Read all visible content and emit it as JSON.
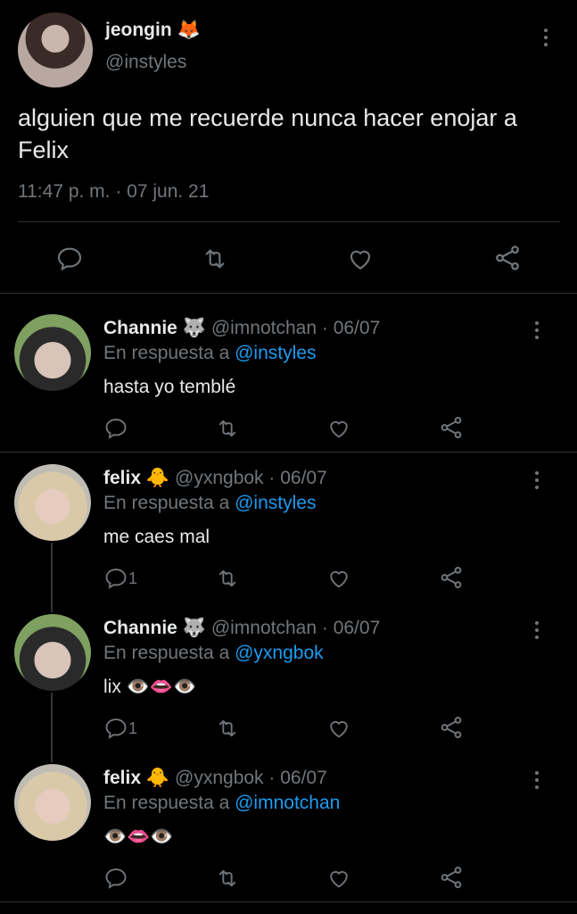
{
  "main_tweet": {
    "name": "jeongin 🦊",
    "handle": "@instyles",
    "text": "alguien que me recuerde nunca hacer enojar a Felix",
    "meta": "11:47 p. m. · 07 jun. 21"
  },
  "replies": [
    {
      "name": "Channie 🐺",
      "handle": "@imnotchan · 06/07",
      "reply_prefix": "En respuesta a",
      "mention": "@instyles",
      "text": "hasta yo temblé",
      "reply_count": ""
    },
    {
      "name": "felix 🐥",
      "handle": "@yxngbok · 06/07",
      "reply_prefix": "En respuesta a",
      "mention": "@instyles",
      "text": "me caes mal",
      "reply_count": "1"
    },
    {
      "name": "Channie 🐺",
      "handle": "@imnotchan · 06/07",
      "reply_prefix": "En respuesta a",
      "mention": "@yxngbok",
      "text": "lix 👁️👄👁️",
      "reply_count": "1"
    },
    {
      "name": "felix 🐥",
      "handle": "@yxngbok · 06/07",
      "reply_prefix": "En respuesta a",
      "mention": "@imnotchan",
      "text": "👁️👄👁️",
      "reply_count": ""
    }
  ],
  "colors": {
    "background": "#000000",
    "text": "#e7e9ea",
    "secondary": "#71767b",
    "link": "#1d9bf0",
    "divider": "#2f3336"
  },
  "icons": [
    "reply-icon",
    "retweet-icon",
    "like-icon",
    "share-icon",
    "more-icon"
  ]
}
